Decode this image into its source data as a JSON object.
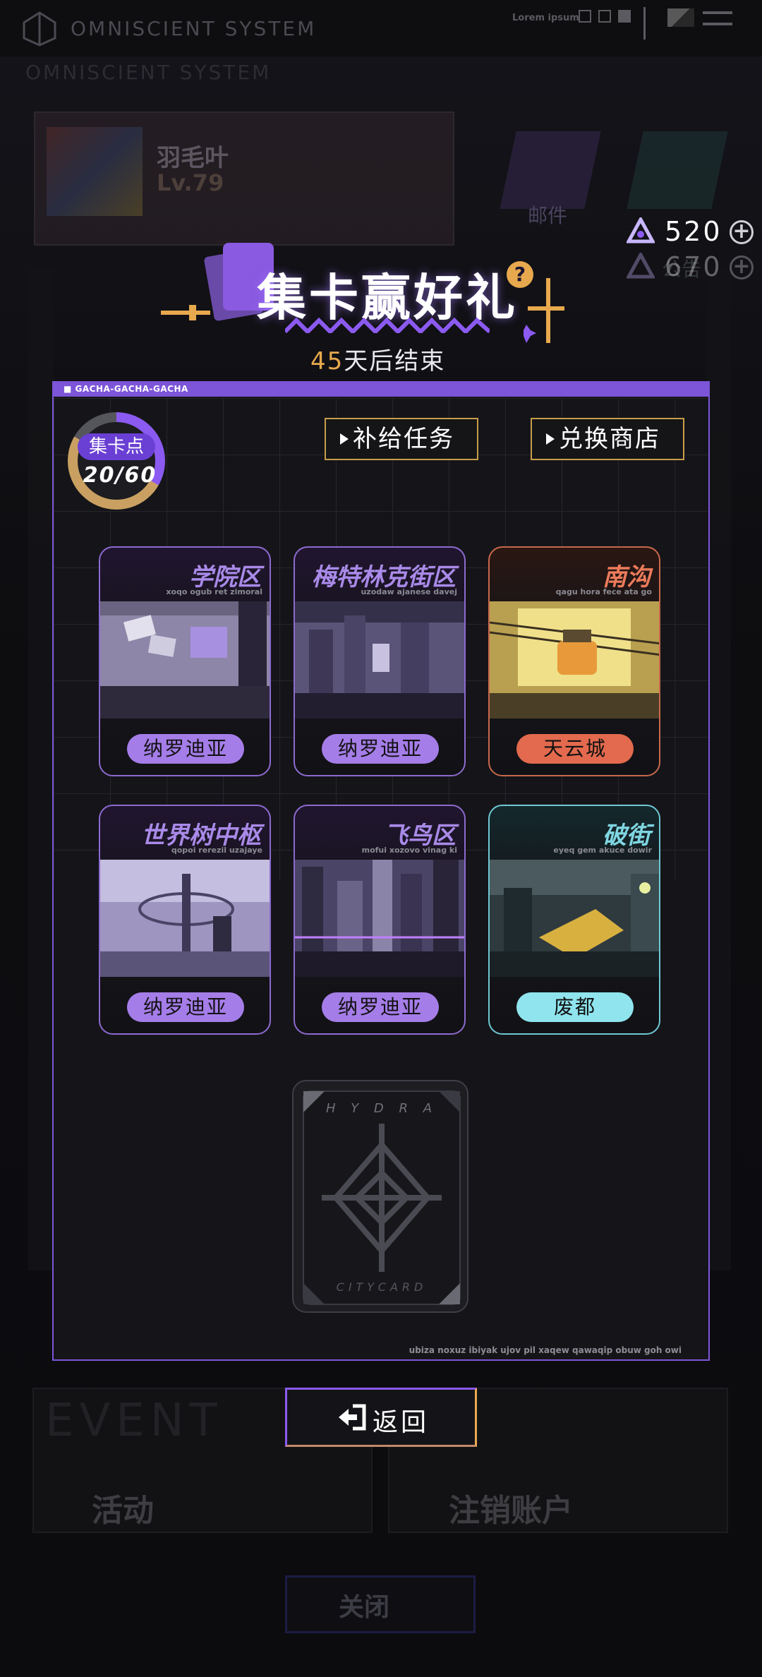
{
  "background": {
    "system_title": "OMNISCIENT SYSTEM",
    "lorem": "Lorem ipsum",
    "profile_name": "羽毛叶",
    "profile_level": "Lv.79",
    "mail_label": "邮件",
    "notice_label": "公告",
    "event_title": "EVENT",
    "event_label": "活动",
    "logout_label": "注销账户",
    "close_label": "关闭"
  },
  "header": {
    "currency_value": "520",
    "currency_value_ghost": "670",
    "title": "集卡赢好礼",
    "help_mark": "?",
    "days_left": "45",
    "ends_text": "天后结束"
  },
  "panel": {
    "header_text": "■ GACHA-GACHA-GACHA",
    "footer_text": "ubiza noxuz ibiyak ujov pil xaqew qawaqip obuw goh owi",
    "points_label": "集卡点",
    "points_value": "20/60",
    "points_progress": 0.333,
    "tab_tasks": "补给任务",
    "tab_shop": "兑换商店",
    "districts": [
      {
        "name": "学院区",
        "sub": "xoqo ogub ret zimoral",
        "badge": "纳罗迪亚",
        "theme": "purple"
      },
      {
        "name": "梅特林克街区",
        "sub": "uzodaw ajanese davej",
        "badge": "纳罗迪亚",
        "theme": "purple"
      },
      {
        "name": "南沟",
        "sub": "qagu hora fece ata go",
        "badge": "天云城",
        "theme": "orange"
      },
      {
        "name": "世界树中枢",
        "sub": "qopoi rerezil uzajaye",
        "badge": "纳罗迪亚",
        "theme": "purple"
      },
      {
        "name": "飞鸟区",
        "sub": "mofui xozovo vinag ki",
        "badge": "纳罗迪亚",
        "theme": "purple"
      },
      {
        "name": "破街",
        "sub": "eyeq gem akuce dowir",
        "badge": "废都",
        "theme": "cyan"
      }
    ],
    "hydra_top": "H Y D R A",
    "hydra_bottom": "CITYCARD"
  },
  "back_button": {
    "label": "返回"
  },
  "colors": {
    "accent_purple": "#7c55d8",
    "accent_gold": "#e8a94e",
    "orange": "#e36a4e",
    "cyan": "#8fe4ee"
  }
}
